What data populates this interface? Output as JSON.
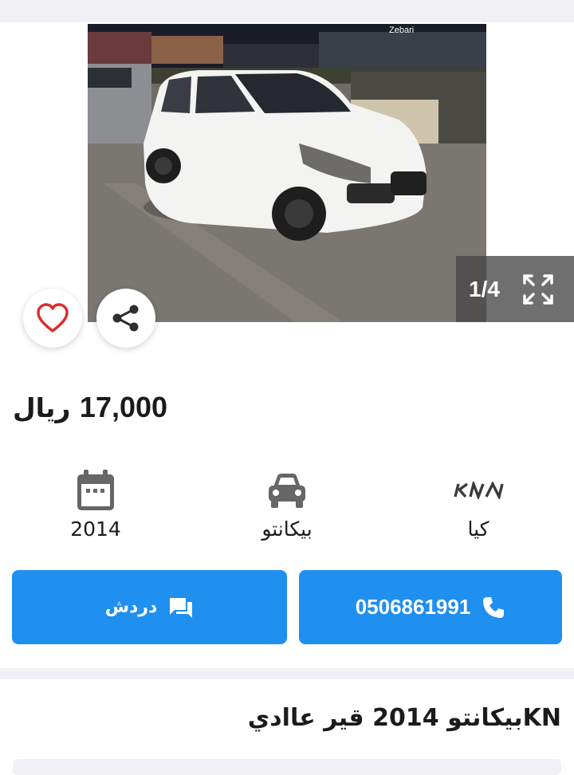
{
  "gallery": {
    "counter": "1/4",
    "storefront_sign": "Zebari",
    "prev_icon": "chevron-left-icon",
    "next_icon": "chevron-right-icon",
    "fullscreen_icon": "expand-icon"
  },
  "actions": {
    "favorite_icon": "heart-icon",
    "share_icon": "share-icon"
  },
  "price": {
    "amount": "17,000",
    "currency": "ريال"
  },
  "specs": [
    {
      "icon": "calendar-icon",
      "label": "2014"
    },
    {
      "icon": "car-icon",
      "label": "بيكانتو"
    },
    {
      "icon": "kia-logo",
      "label": "كيا"
    }
  ],
  "buttons": {
    "chat_label": "دردش",
    "chat_icon": "chat-icon",
    "phone_label": "0506861991",
    "phone_icon": "phone-icon"
  },
  "listing": {
    "title": "KNبيكانتو 2014 قير عاادي"
  },
  "colors": {
    "accent": "#1f8ff0",
    "heart": "#d9302f",
    "separator": "#f1f1f5"
  }
}
